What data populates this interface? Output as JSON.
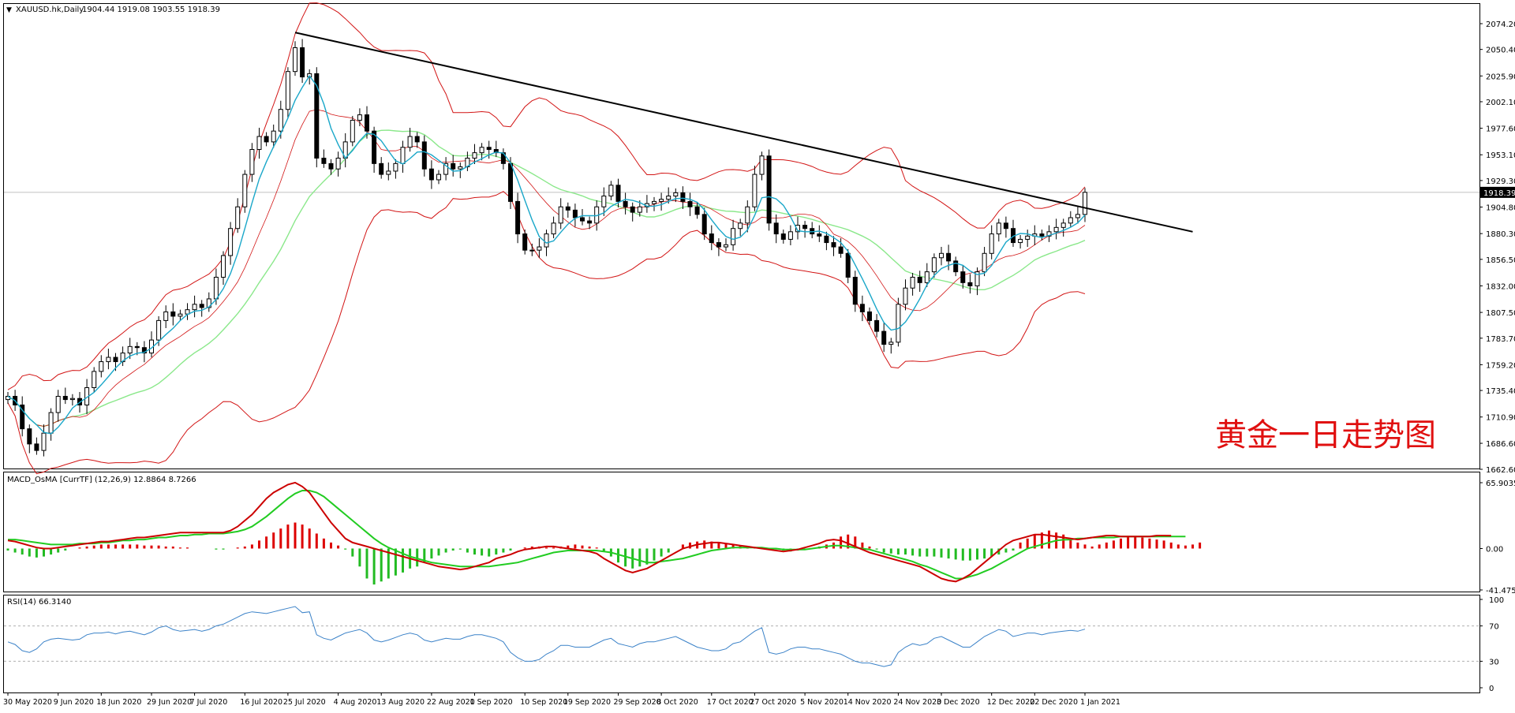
{
  "window": {
    "symbol_label": "XAUUSD.hk,Daily",
    "ohlc_label": "1904.44 1919.08 1903.55 1918.39",
    "current_price_label": "1918.39",
    "watermark_text": "黄金一日走势图"
  },
  "colors": {
    "background": "#ffffff",
    "bull_candle": "#ffffff",
    "bear_candle": "#000000",
    "candle_outline": "#000000",
    "bollinger": "#d21414",
    "ma_fast": "#1aa7c9",
    "ma_slow": "#8be88b",
    "trendline": "#000000",
    "macd_line": "#cc0000",
    "signal_line": "#22cc22",
    "hist_pos": "#dd0000",
    "hist_neg": "#22bb22",
    "rsi_line": "#3b82c8",
    "watermark": "#e01010"
  },
  "chart_data": [
    {
      "type": "candlestick",
      "title": "XAUUSD.hk,Daily",
      "price_axis_labels": [
        "2074.20",
        "2050.40",
        "2025.90",
        "2002.10",
        "1977.60",
        "1953.10",
        "1929.30",
        "1904.80",
        "1880.30",
        "1856.50",
        "1832.00",
        "1807.50",
        "1783.70",
        "1759.20",
        "1735.40",
        "1710.90",
        "1686.60",
        "1662.60"
      ],
      "ylim": [
        1662.6,
        2074.2
      ],
      "date_labels": [
        "30 May 2020",
        "9 Jun 2020",
        "18 Jun 2020",
        "29 Jun 2020",
        "7 Jul 2020",
        "16 Jul 2020",
        "25 Jul 2020",
        "4 Aug 2020",
        "13 Aug 2020",
        "22 Aug 2020",
        "1 Sep 2020",
        "10 Sep 2020",
        "19 Sep 2020",
        "29 Sep 2020",
        "8 Oct 2020",
        "17 Oct 2020",
        "27 Oct 2020",
        "5 Nov 2020",
        "14 Nov 2020",
        "24 Nov 2020",
        "3 Dec 2020",
        "12 Dec 2020",
        "22 Dec 2020",
        "1 Jan 2021"
      ],
      "closes": [
        1730,
        1722,
        1700,
        1686,
        1680,
        1696,
        1715,
        1730,
        1727,
        1728,
        1722,
        1738,
        1753,
        1762,
        1766,
        1762,
        1770,
        1776,
        1775,
        1770,
        1782,
        1800,
        1808,
        1804,
        1806,
        1810,
        1815,
        1812,
        1820,
        1840,
        1860,
        1885,
        1905,
        1935,
        1958,
        1970,
        1965,
        1975,
        1995,
        2030,
        2052,
        2025,
        2028,
        1950,
        1945,
        1940,
        1950,
        1965,
        1985,
        1990,
        1975,
        1945,
        1935,
        1938,
        1945,
        1960,
        1970,
        1965,
        1940,
        1930,
        1935,
        1945,
        1940,
        1942,
        1950,
        1955,
        1960,
        1958,
        1955,
        1945,
        1910,
        1880,
        1865,
        1865,
        1868,
        1880,
        1890,
        1905,
        1902,
        1895,
        1892,
        1890,
        1905,
        1915,
        1925,
        1910,
        1905,
        1900,
        1905,
        1908,
        1910,
        1912,
        1915,
        1918,
        1910,
        1905,
        1898,
        1880,
        1872,
        1868,
        1870,
        1885,
        1890,
        1905,
        1935,
        1952,
        1890,
        1880,
        1875,
        1882,
        1888,
        1885,
        1880,
        1878,
        1872,
        1868,
        1862,
        1840,
        1815,
        1808,
        1800,
        1790,
        1778,
        1780,
        1815,
        1830,
        1840,
        1835,
        1845,
        1858,
        1862,
        1855,
        1845,
        1835,
        1832,
        1845,
        1862,
        1880,
        1890,
        1885,
        1872,
        1875,
        1878,
        1880,
        1878,
        1882,
        1886,
        1890,
        1895,
        1898,
        1918.39
      ],
      "highs_note": "",
      "trendline": {
        "from": {
          "bar": 40,
          "price": 2066
        },
        "to": {
          "bar": 165,
          "price": 1882
        }
      },
      "series": [
        {
          "name": ""
        }
      ]
    },
    {
      "type": "bar",
      "title": "MACD_OsMA [CurrTF] (12,26,9) 12.8864 8.7266",
      "axis_labels": [
        "65.9035",
        "0.00",
        "-41.475"
      ],
      "ylim": [
        -41.475,
        65.9035
      ],
      "histogram": [
        -2,
        -4,
        -6,
        -8,
        -9,
        -8,
        -6,
        -4,
        -2,
        0,
        1,
        2,
        3,
        4,
        4,
        4,
        4,
        4,
        4,
        3,
        3,
        3,
        2,
        2,
        1,
        1,
        0,
        0,
        0,
        -1,
        -1,
        0,
        1,
        2,
        4,
        8,
        12,
        16,
        20,
        24,
        26,
        24,
        20,
        15,
        10,
        6,
        3,
        -1,
        -8,
        -18,
        -30,
        -36,
        -33,
        -30,
        -27,
        -24,
        -20,
        -18,
        -14,
        -10,
        -7,
        -4,
        -2,
        -1,
        -4,
        -6,
        -7,
        -8,
        -6,
        -4,
        -2,
        0,
        1,
        2,
        2,
        1,
        1,
        2,
        3,
        4,
        3,
        2,
        1,
        -3,
        -8,
        -14,
        -18,
        -20,
        -18,
        -16,
        -12,
        -8,
        -4,
        0,
        4,
        6,
        7,
        8,
        7,
        6,
        5,
        4,
        3,
        2,
        1,
        0,
        0,
        -1,
        -2,
        -3,
        -2,
        -1,
        0,
        2,
        4,
        6,
        12,
        14,
        12,
        6,
        2,
        -1,
        -4,
        -5,
        -6,
        -6,
        -7,
        -8,
        -8,
        -8,
        -9,
        -10,
        -11,
        -12,
        -12,
        -11,
        -10,
        -8,
        -6,
        -4,
        -2,
        6,
        10,
        14,
        16,
        18,
        16,
        14,
        10,
        6,
        4,
        2,
        4,
        6,
        8,
        10,
        12,
        12,
        11,
        10,
        9,
        8,
        6,
        4,
        3,
        4,
        6
      ],
      "macd_series": [
        8,
        7,
        5,
        3,
        1,
        0,
        0,
        1,
        2,
        3,
        4,
        5,
        6,
        7,
        7,
        8,
        9,
        10,
        11,
        11,
        12,
        13,
        14,
        15,
        16,
        16,
        16,
        16,
        16,
        16,
        16,
        18,
        22,
        28,
        34,
        42,
        50,
        56,
        60,
        64,
        66,
        62,
        56,
        46,
        36,
        26,
        18,
        10,
        6,
        4,
        2,
        0,
        -2,
        -4,
        -6,
        -8,
        -10,
        -12,
        -14,
        -16,
        -18,
        -19,
        -20,
        -21,
        -20,
        -18,
        -16,
        -14,
        -10,
        -8,
        -6,
        -3,
        -1,
        0,
        1,
        2,
        2,
        1,
        0,
        -1,
        -2,
        -3,
        -5,
        -10,
        -14,
        -18,
        -22,
        -24,
        -22,
        -20,
        -16,
        -12,
        -8,
        -4,
        0,
        2,
        4,
        5,
        6,
        6,
        5,
        4,
        3,
        2,
        1,
        0,
        -1,
        -2,
        -3,
        -2,
        -1,
        1,
        3,
        5,
        8,
        9,
        8,
        5,
        2,
        -1,
        -4,
        -6,
        -8,
        -10,
        -12,
        -14,
        -16,
        -18,
        -22,
        -26,
        -30,
        -32,
        -33,
        -30,
        -26,
        -20,
        -14,
        -8,
        -2,
        4,
        8,
        10,
        12,
        14,
        14,
        13,
        12,
        11,
        10,
        9,
        10,
        11,
        12,
        13,
        13,
        12,
        12,
        12,
        12,
        12,
        13,
        13,
        12.8864
      ],
      "signal_series": [
        9,
        9,
        8,
        7,
        6,
        5,
        4,
        4,
        4,
        4,
        5,
        5,
        5,
        6,
        6,
        7,
        8,
        8,
        9,
        9,
        10,
        11,
        11,
        12,
        13,
        13,
        14,
        14,
        15,
        15,
        15,
        16,
        17,
        19,
        22,
        27,
        32,
        38,
        44,
        50,
        55,
        58,
        58,
        56,
        52,
        46,
        40,
        34,
        28,
        22,
        16,
        10,
        5,
        1,
        -2,
        -5,
        -8,
        -10,
        -12,
        -14,
        -15,
        -16,
        -17,
        -18,
        -18,
        -18,
        -18,
        -18,
        -17,
        -16,
        -15,
        -14,
        -12,
        -10,
        -8,
        -6,
        -4,
        -3,
        -2,
        -2,
        -2,
        -2,
        -2,
        -3,
        -4,
        -6,
        -8,
        -10,
        -12,
        -14,
        -14,
        -13,
        -12,
        -11,
        -10,
        -8,
        -6,
        -4,
        -2,
        -1,
        0,
        1,
        1,
        1,
        1,
        1,
        0,
        0,
        -1,
        -1,
        -1,
        -1,
        0,
        1,
        2,
        3,
        3,
        2,
        1,
        0,
        -1,
        -3,
        -5,
        -7,
        -9,
        -11,
        -13,
        -16,
        -18,
        -21,
        -24,
        -27,
        -30,
        -30,
        -28,
        -26,
        -23,
        -20,
        -16,
        -12,
        -8,
        -4,
        0,
        2,
        4,
        6,
        8,
        8.7266,
        9,
        10,
        10,
        11,
        11,
        11,
        11,
        12,
        12,
        12,
        12,
        12,
        12,
        12,
        12,
        12,
        12
      ],
      "series": [
        {
          "name": ""
        },
        {
          "name": ""
        }
      ]
    },
    {
      "type": "line",
      "title": "RSI(14) 66.3140",
      "axis_labels": [
        "100",
        "70",
        "30",
        "0"
      ],
      "ylim": [
        0,
        100
      ],
      "levels": [
        70,
        30
      ],
      "values": [
        52,
        49,
        42,
        40,
        44,
        52,
        55,
        56,
        55,
        54,
        55,
        60,
        62,
        62,
        63,
        61,
        63,
        64,
        62,
        60,
        63,
        68,
        70,
        66,
        64,
        65,
        66,
        64,
        66,
        70,
        72,
        76,
        80,
        84,
        86,
        85,
        84,
        86,
        88,
        90,
        92,
        85,
        86,
        60,
        56,
        54,
        58,
        62,
        64,
        66,
        62,
        54,
        52,
        54,
        57,
        60,
        62,
        60,
        54,
        52,
        54,
        56,
        55,
        55,
        58,
        60,
        60,
        58,
        56,
        52,
        40,
        34,
        30,
        30,
        32,
        38,
        42,
        48,
        48,
        46,
        46,
        46,
        50,
        54,
        56,
        50,
        48,
        46,
        50,
        52,
        52,
        54,
        56,
        58,
        54,
        50,
        46,
        44,
        42,
        42,
        44,
        50,
        52,
        58,
        64,
        68,
        40,
        38,
        40,
        44,
        46,
        46,
        44,
        44,
        42,
        40,
        38,
        34,
        30,
        28,
        28,
        26,
        24,
        26,
        40,
        46,
        50,
        48,
        50,
        56,
        58,
        54,
        50,
        46,
        46,
        52,
        58,
        62,
        66,
        64,
        58,
        60,
        62,
        62,
        60,
        62,
        63,
        64,
        65,
        64,
        66.314
      ],
      "series": [
        {
          "name": ""
        }
      ]
    }
  ]
}
